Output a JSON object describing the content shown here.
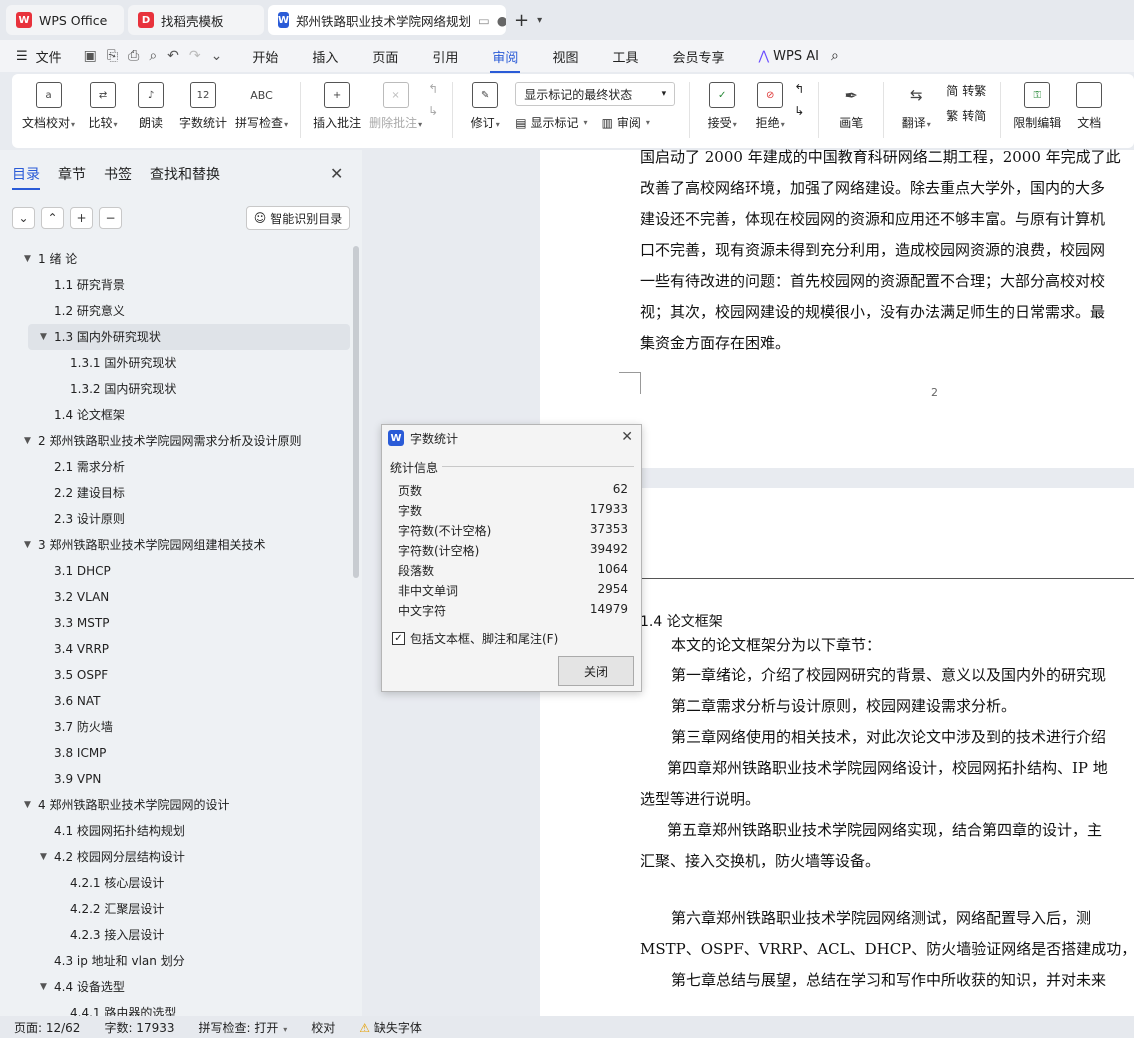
{
  "tabs": [
    {
      "label": "WPS Office",
      "logo": "W"
    },
    {
      "label": "找稻壳模板",
      "logo": "D"
    },
    {
      "label": "郑州铁路职业技术学院网络规划",
      "logo": "W"
    }
  ],
  "menu": {
    "file": "文件",
    "items": [
      "开始",
      "插入",
      "页面",
      "引用",
      "审阅",
      "视图",
      "工具",
      "会员专享"
    ],
    "active": "审阅",
    "ai": "WPS AI"
  },
  "ribbon": {
    "doc_check": "文档校对",
    "compare": "比较",
    "read": "朗读",
    "word_count": "字数统计",
    "spell": "拼写检查",
    "insert_comment": "插入批注",
    "delete_comment": "删除批注",
    "track": "修订",
    "markup_state": "显示标记的最终状态",
    "show_markup": "显示标记",
    "review": "审阅",
    "accept": "接受",
    "reject": "拒绝",
    "pen": "画笔",
    "translate": "翻译",
    "to_trad": "转繁",
    "to_simp": "转简",
    "restrict": "限制编辑",
    "doc": "文档"
  },
  "sidebar": {
    "tabs": [
      "目录",
      "章节",
      "书签",
      "查找和替换"
    ],
    "active_tab": "目录",
    "smart": "智能识别目录",
    "toc": [
      {
        "label": "1  绪  论",
        "level": 1,
        "arrow": true
      },
      {
        "label": "1.1  研究背景",
        "level": 2
      },
      {
        "label": "1.2  研究意义",
        "level": 2
      },
      {
        "label": "1.3  国内外研究现状",
        "level": 2,
        "arrow": true,
        "selected": true
      },
      {
        "label": "1.3.1  国外研究现状",
        "level": 3
      },
      {
        "label": "1.3.2  国内研究现状",
        "level": 3
      },
      {
        "label": "1.4  论文框架",
        "level": 2
      },
      {
        "label": "2  郑州铁路职业技术学院园网需求分析及设计原则",
        "level": 1,
        "arrow": true
      },
      {
        "label": "2.1  需求分析",
        "level": 2
      },
      {
        "label": "2.2  建设目标",
        "level": 2
      },
      {
        "label": "2.3  设计原则",
        "level": 2
      },
      {
        "label": "3  郑州铁路职业技术学院园网组建相关技术",
        "level": 1,
        "arrow": true
      },
      {
        "label": "3.1 DHCP",
        "level": 2
      },
      {
        "label": "3.2 VLAN",
        "level": 2
      },
      {
        "label": "3.3 MSTP",
        "level": 2
      },
      {
        "label": "3.4 VRRP",
        "level": 2
      },
      {
        "label": "3.5 OSPF",
        "level": 2
      },
      {
        "label": "3.6 NAT",
        "level": 2
      },
      {
        "label": "3.7  防火墙",
        "level": 2
      },
      {
        "label": "3.8 ICMP",
        "level": 2
      },
      {
        "label": "3.9 VPN",
        "level": 2
      },
      {
        "label": "4  郑州铁路职业技术学院园网的设计",
        "level": 1,
        "arrow": true
      },
      {
        "label": "4.1  校园网拓扑结构规划",
        "level": 2
      },
      {
        "label": "4.2  校园网分层结构设计",
        "level": 2,
        "arrow": true
      },
      {
        "label": "4.2.1  核心层设计",
        "level": 3
      },
      {
        "label": "4.2.2  汇聚层设计",
        "level": 3
      },
      {
        "label": "4.2.3  接入层设计",
        "level": 3
      },
      {
        "label": "4.3 ip 地址和 vlan 划分",
        "level": 2
      },
      {
        "label": "4.4  设备选型",
        "level": 2,
        "arrow": true
      },
      {
        "label": "4.4.1  路由器的选型",
        "level": 3
      }
    ]
  },
  "page1": {
    "lines": [
      "国启动了 2000 年建成的中国教育科研网络二期工程，2000 年完成了此",
      "改善了高校网络环境，加强了网络建设。除去重点大学外，国内的大多",
      "建设还不完善，体现在校园网的资源和应用还不够丰富。与原有计算机",
      "口不完善，现有资源未得到充分利用，造成校园网资源的浪费，校园网",
      "一些有待改进的问题：首先校园网的资源配置不合理；大部分高校对校",
      "视；其次，校园网建设的规模很小，没有办法满足师生的日常需求。最",
      "集资金方面存在困难。"
    ],
    "page_number": "2"
  },
  "page2": {
    "heading": "1.4  论文框架",
    "lines": [
      "本文的论文框架分为以下章节：",
      "第一章绪论，介绍了校园网研究的背景、意义以及国内外的研究现",
      "第二章需求分析与设计原则，校园网建设需求分析。",
      "第三章网络使用的相关技术，对此次论文中涉及到的技术进行介绍",
      "第四章郑州铁路职业技术学院园网络设计，校园网拓扑结构、IP 地",
      "选型等进行说明。",
      "第五章郑州铁路职业技术学院园网络实现，结合第四章的设计，主",
      "汇聚、接入交换机，防火墙等设备。",
      "第六章郑州铁路职业技术学院园网络测试，网络配置导入后，测",
      "MSTP、OSPF、VRRP、ACL、DHCP、防火墙验证网络是否搭建成功，网",
      "第七章总结与展望，总结在学习和写作中所收获的知识，并对未来"
    ]
  },
  "dialog": {
    "title": "字数统计",
    "section": "统计信息",
    "stats": [
      {
        "label": "页数",
        "value": "62"
      },
      {
        "label": "字数",
        "value": "17933"
      },
      {
        "label": "字符数(不计空格)",
        "value": "37353"
      },
      {
        "label": "字符数(计空格)",
        "value": "39492"
      },
      {
        "label": "段落数",
        "value": "1064"
      },
      {
        "label": "非中文单词",
        "value": "2954"
      },
      {
        "label": "中文字符",
        "value": "14979"
      }
    ],
    "include_label": "包括文本框、脚注和尾注(F)",
    "include_checked": true,
    "close_button": "关闭"
  },
  "status": {
    "page": "页面: 12/62",
    "words": "字数: 17933",
    "spell": "拼写检查: 打开",
    "proof": "校对",
    "missing_font": "缺失字体"
  },
  "colors": {
    "accent": "#2a5bd7",
    "wps_red": "#e8323c",
    "wps_blue": "#2a5bd7"
  }
}
